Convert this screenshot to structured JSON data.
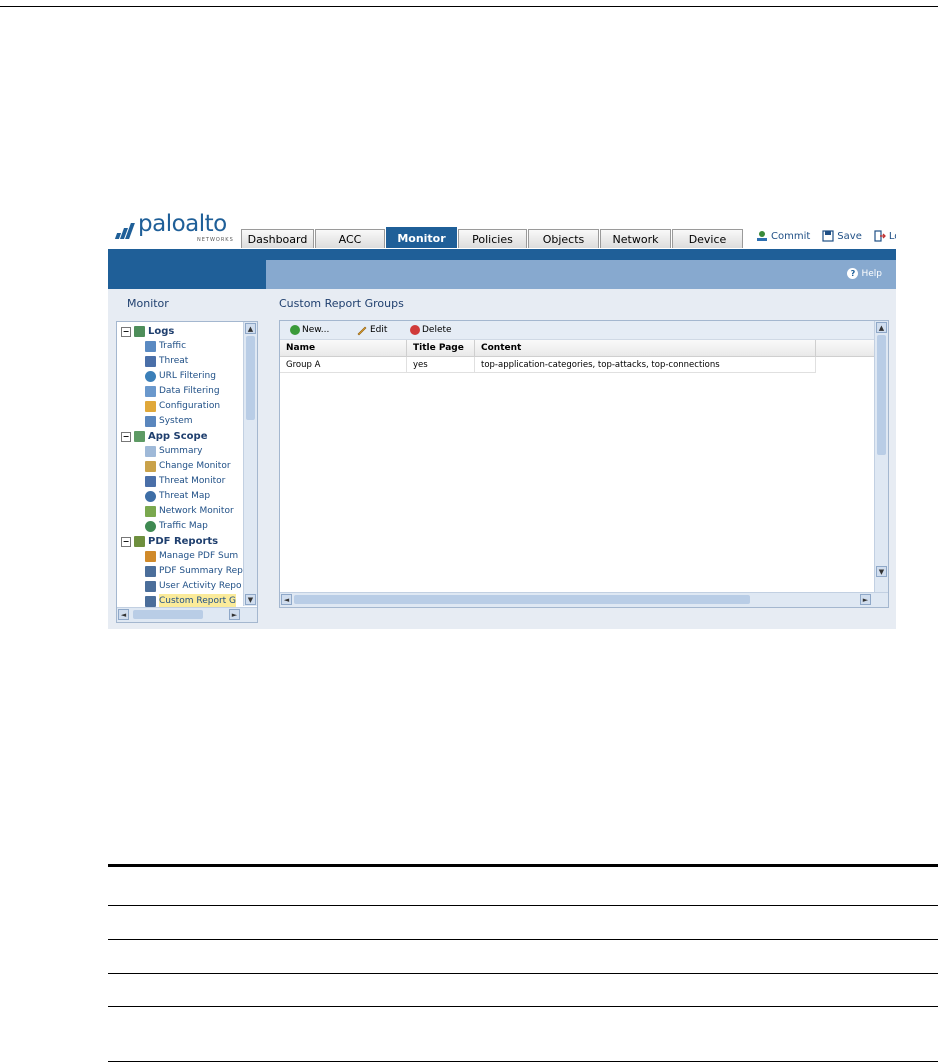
{
  "brand": {
    "name": "paloalto",
    "sub": "NETWORKS",
    "color": "#1f5f98"
  },
  "tabs": [
    {
      "label": "Dashboard",
      "active": false
    },
    {
      "label": "ACC",
      "active": false
    },
    {
      "label": "Monitor",
      "active": true
    },
    {
      "label": "Policies",
      "active": false
    },
    {
      "label": "Objects",
      "active": false
    },
    {
      "label": "Network",
      "active": false
    },
    {
      "label": "Device",
      "active": false
    }
  ],
  "actions": {
    "commit": "Commit",
    "save": "Save",
    "logout": "Lo"
  },
  "help": {
    "label": "Help"
  },
  "sidebar": {
    "title": "Monitor",
    "groups": [
      {
        "label": "Logs",
        "toggle": "−",
        "items": [
          "Traffic",
          "Threat",
          "URL Filtering",
          "Data Filtering",
          "Configuration",
          "System"
        ]
      },
      {
        "label": "App Scope",
        "toggle": "−",
        "items": [
          "Summary",
          "Change Monitor",
          "Threat Monitor",
          "Threat Map",
          "Network Monitor",
          "Traffic Map"
        ]
      },
      {
        "label": "PDF Reports",
        "toggle": "−",
        "items": [
          "Manage PDF Sum",
          "PDF Summary Rep",
          "User Activity Repo",
          "Custom Report G"
        ]
      }
    ],
    "selected": "Custom Report G"
  },
  "main": {
    "title": "Custom Report Groups",
    "toolbar": {
      "new": "New...",
      "edit": "Edit",
      "delete": "Delete"
    },
    "columns": [
      "Name",
      "Title Page",
      "Content"
    ],
    "rows": [
      {
        "name": "Group A",
        "title_page": "yes",
        "content": "top-application-categories, top-attacks, top-connections"
      }
    ]
  },
  "scroll": {
    "up": "▲",
    "down": "▼",
    "left": "◄",
    "right": "►",
    "grip": "III",
    "grip_v": "≡"
  }
}
